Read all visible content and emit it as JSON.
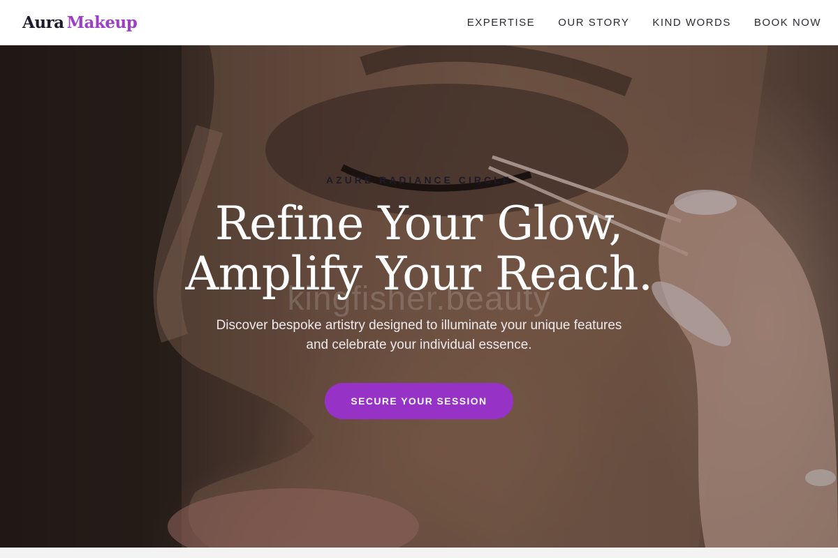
{
  "brand": {
    "name_part1": "Aura",
    "name_part2": "Makeup",
    "accent_color": "#9b3fc9"
  },
  "nav": {
    "items": [
      {
        "label": "EXPERTISE"
      },
      {
        "label": "OUR STORY"
      },
      {
        "label": "KIND WORDS"
      },
      {
        "label": "BOOK NOW"
      }
    ]
  },
  "hero": {
    "eyebrow": "AZURE RADIANCE CIRCLE",
    "headline_line1": "Refine Your Glow,",
    "headline_line2": "Amplify Your Reach.",
    "watermark": "kingfisher.beauty",
    "subtitle_line1": "Discover bespoke artistry designed to illuminate your unique features",
    "subtitle_line2": "and celebrate your individual essence.",
    "cta_label": "SECURE YOUR SESSION",
    "cta_color": "#9732c7",
    "image_subject": "close-up makeup application on eye photo"
  }
}
